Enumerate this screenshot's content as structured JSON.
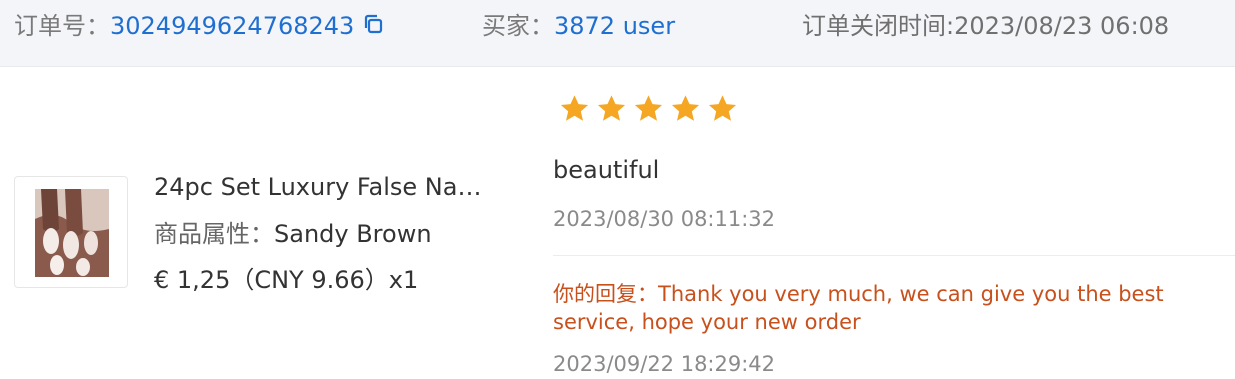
{
  "header": {
    "order_label": "订单号：",
    "order_number": "3024949624768243",
    "buyer_label": "买家：",
    "buyer_name": "3872 user",
    "close_time": "订单关闭时间:2023/08/23 06:08",
    "copy_icon": "copy-icon"
  },
  "product": {
    "title": "24pc Set Luxury False Nai...",
    "attr_label": "商品属性：",
    "attr_value": "Sandy Brown",
    "price": "€ 1,25（CNY  9.66）x1",
    "image_icon": "nail-product-thumbnail"
  },
  "review": {
    "rating": 5,
    "max_rating": 5,
    "star_color": "#f5a623",
    "text": "beautiful",
    "date": "2023/08/30 08:11:32",
    "reply_label": "你的回复：",
    "reply_text": "Thank you very much, we can give you the best service, hope your new order",
    "reply_date": "2023/09/22 18:29:42"
  },
  "colors": {
    "link": "#1f6fd1",
    "reply": "#c8501c",
    "header_bg": "#f3f5f8"
  }
}
